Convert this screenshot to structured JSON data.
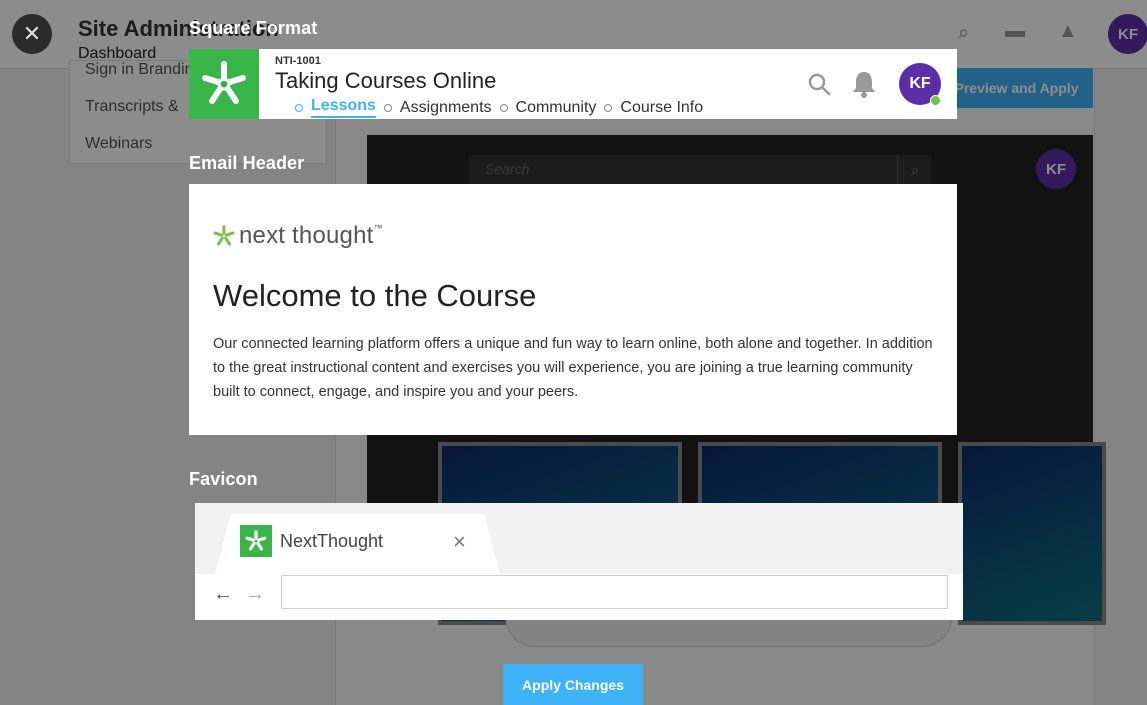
{
  "background_page": {
    "title": "Site Administration",
    "tab": "Dashboard",
    "menu_items": [
      "Sign in Branding",
      "Transcripts & ",
      "Webinars"
    ],
    "preview_button": "Preview and Apply",
    "search_placeholder": "Search",
    "avatar_initials": "KF"
  },
  "close_button": {
    "icon": "close-icon"
  },
  "square_format": {
    "label": "Square Format",
    "course_code": "NTI-1001",
    "course_title": "Taking Courses Online",
    "nav": [
      "Lessons",
      "Assignments",
      "Community",
      "Course Info"
    ],
    "active_nav": "Lessons",
    "avatar_initials": "KF"
  },
  "email_header": {
    "label": "Email Header",
    "logo_text": "next thought",
    "logo_tm": "™",
    "heading": "Welcome to the Course",
    "body": "Our connected learning platform offers a unique and fun way to learn online, both alone and together. In addition to the great instructional content and exercises you will experience, you are joining a true learning community built to connect, engage, and inspire you and your peers."
  },
  "favicon": {
    "label": "Favicon",
    "tab_title": "NextThought",
    "close_glyph": "×",
    "back_glyph": "←",
    "forward_glyph": "→"
  },
  "apply_button": {
    "label": "Apply Changes"
  },
  "colors": {
    "brand_green": "#3ab54a",
    "accent_blue": "#3fb3f7",
    "avatar_purple": "#5a2ea6",
    "online_green": "#68c843"
  }
}
